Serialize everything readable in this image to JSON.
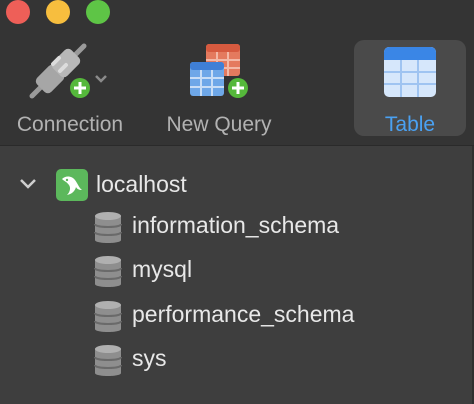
{
  "toolbar": {
    "connection_label": "Connection",
    "new_query_label": "New Query",
    "table_label": "Table"
  },
  "tree": {
    "host": {
      "name": "localhost",
      "expanded": true
    },
    "databases": [
      "information_schema",
      "mysql",
      "performance_schema",
      "sys"
    ]
  },
  "colors": {
    "accent": "#4aa1f2",
    "host_icon": "#5cb85c",
    "close": "#ee5f58",
    "minimize": "#f7be3e",
    "zoom": "#5ec546"
  }
}
